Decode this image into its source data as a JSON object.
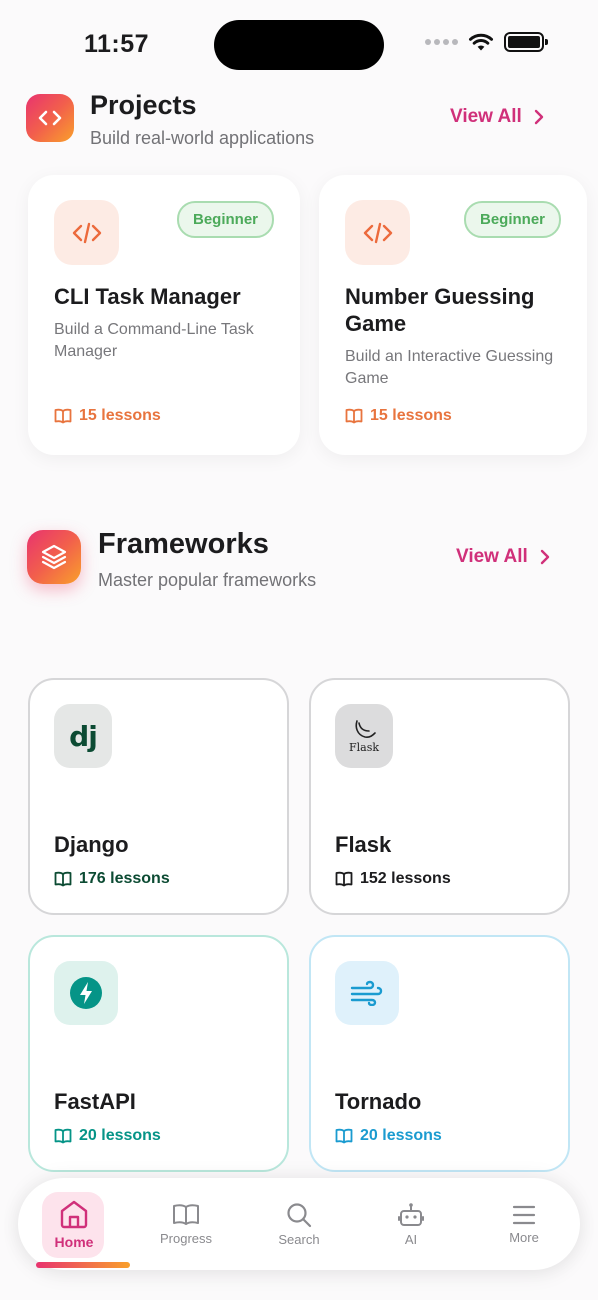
{
  "status": {
    "time": "11:57"
  },
  "projects": {
    "title": "Projects",
    "subtitle": "Build real-world applications",
    "view_all": "View All",
    "items": [
      {
        "title": "CLI Task Manager",
        "description": "Build a Command-Line Task Manager",
        "badge": "Beginner",
        "lessons": "15 lessons"
      },
      {
        "title": "Number Guessing Game",
        "description": "Build an Interactive Guessing Game",
        "badge": "Beginner",
        "lessons": "15 lessons"
      }
    ]
  },
  "frameworks": {
    "title": "Frameworks",
    "subtitle": "Master popular frameworks",
    "view_all": "View All",
    "items": [
      {
        "name": "Django",
        "lessons": "176 lessons",
        "logo_text": "dj"
      },
      {
        "name": "Flask",
        "lessons": "152 lessons",
        "logo_text": "Flask"
      },
      {
        "name": "FastAPI",
        "lessons": "20 lessons"
      },
      {
        "name": "Tornado",
        "lessons": "20 lessons"
      }
    ]
  },
  "tabs": [
    {
      "label": "Home",
      "icon": "home-icon",
      "active": true
    },
    {
      "label": "Progress",
      "icon": "book-icon"
    },
    {
      "label": "Search",
      "icon": "search-icon"
    },
    {
      "label": "AI",
      "icon": "robot-icon"
    },
    {
      "label": "More",
      "icon": "menu-icon"
    }
  ],
  "colors": {
    "accent": "#d0307a",
    "orange": "#e8743e",
    "beginner_green": "#4caa5a",
    "django_green": "#0c4b33",
    "fastapi_teal": "#059487",
    "tornado_blue": "#1a9bd0"
  }
}
